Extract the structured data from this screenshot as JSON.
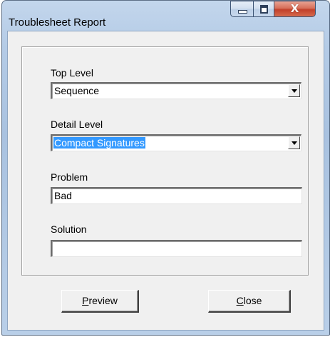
{
  "window": {
    "title": "Troublesheet Report",
    "controls": {
      "minimize": "minimize-icon",
      "maximize": "maximize-icon",
      "close": "close-icon",
      "close_glyph": "X"
    }
  },
  "form": {
    "top_level": {
      "label": "Top Level",
      "value": "Sequence"
    },
    "detail_level": {
      "label": "Detail Level",
      "value": "Compact Signatures"
    },
    "problem": {
      "label": "Problem",
      "value": "Bad"
    },
    "solution": {
      "label": "Solution",
      "value": ""
    }
  },
  "buttons": {
    "preview": {
      "mnemonic": "P",
      "rest": "review"
    },
    "close": {
      "mnemonic": "C",
      "rest": "lose"
    }
  },
  "colors": {
    "selection": "#3399ff",
    "close_button": "#c2402a",
    "frame": "#b4cbe6"
  }
}
